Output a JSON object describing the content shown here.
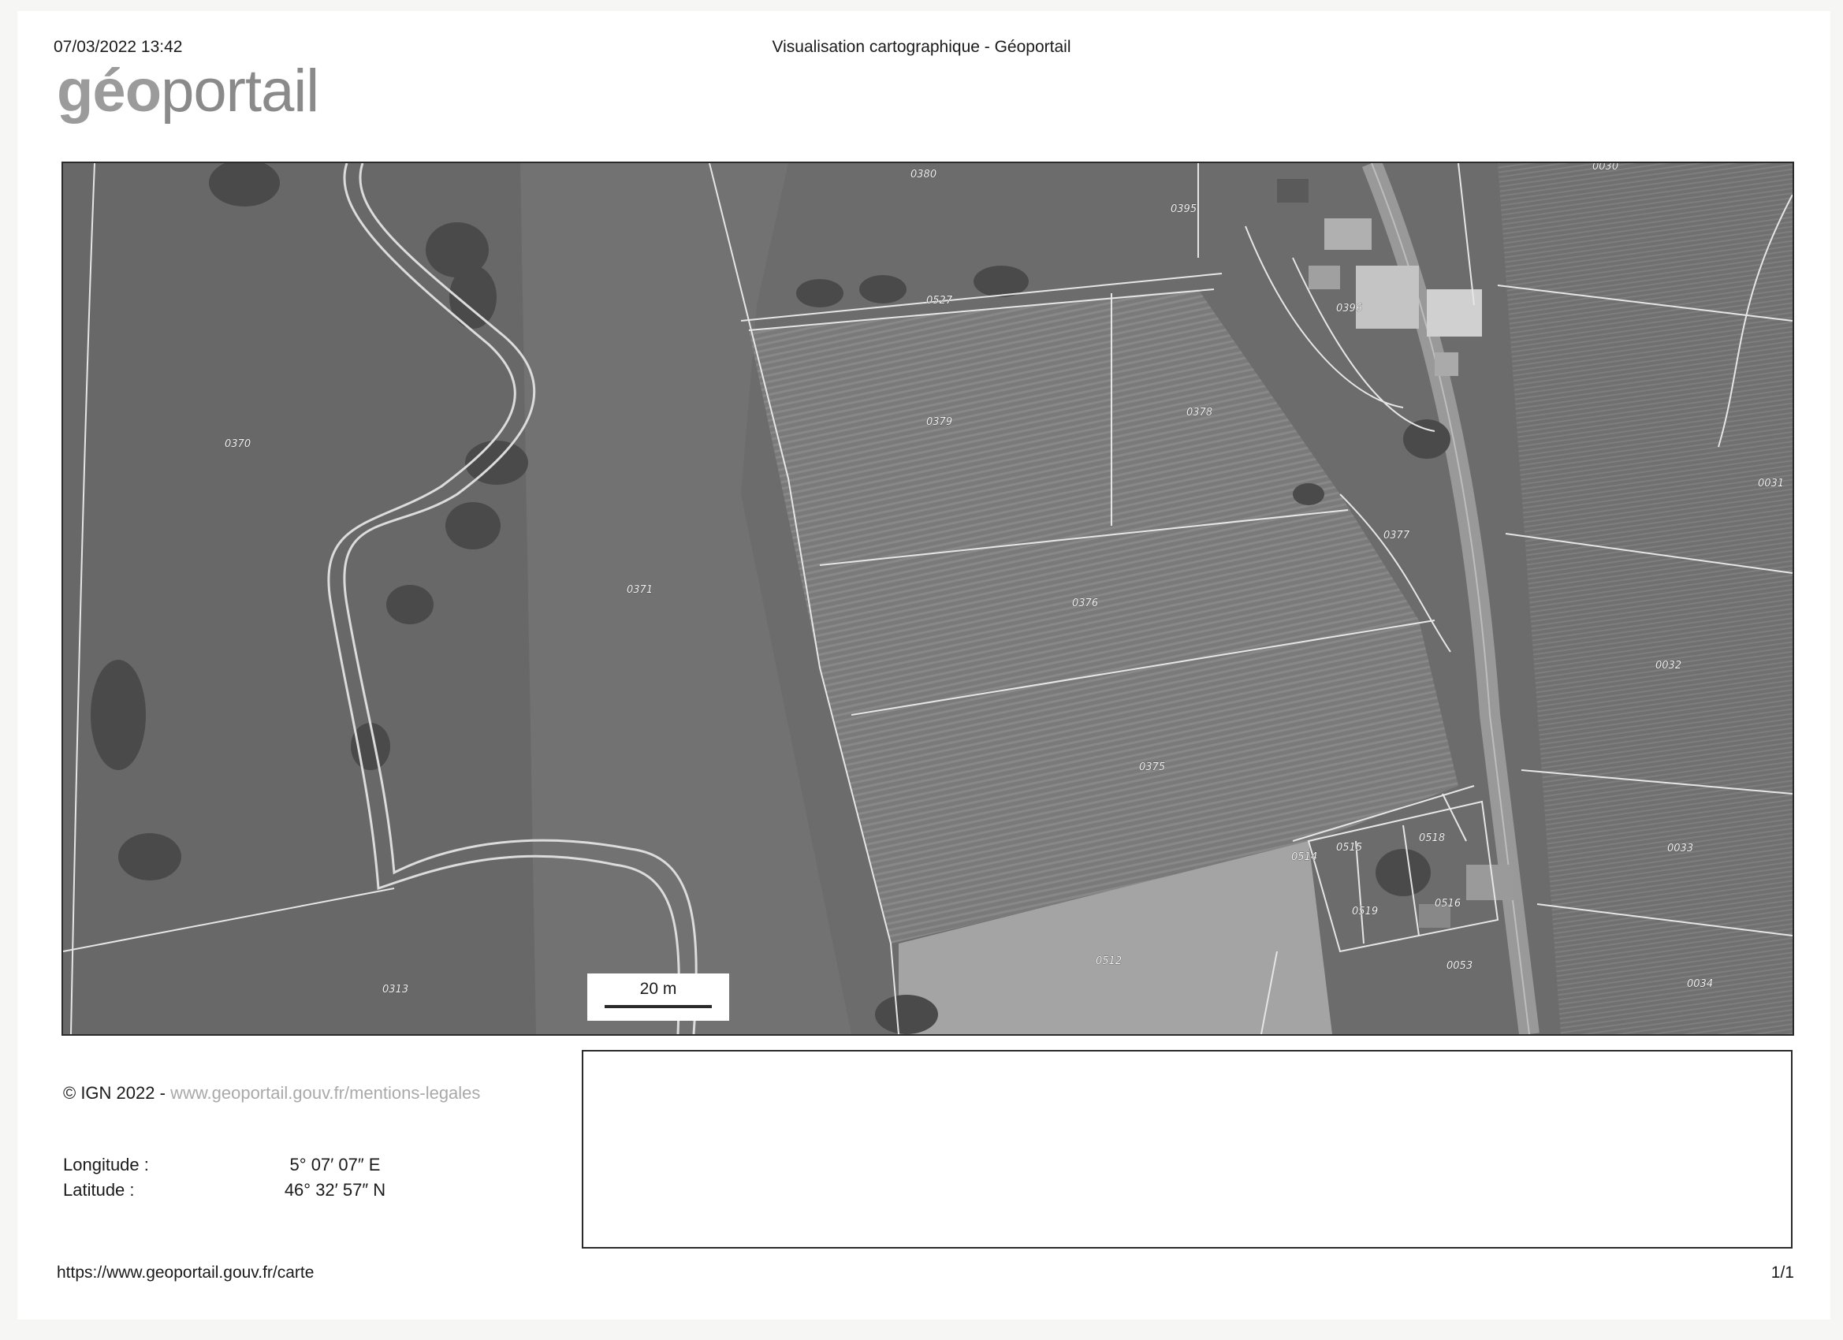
{
  "header": {
    "datetime": "07/03/2022 13:42",
    "title": "Visualisation cartographique - Géoportail"
  },
  "logo": {
    "part1": "géo",
    "part2": "portail"
  },
  "map": {
    "imagery": "aerial-photo-grayscale",
    "scale_label": "20 m",
    "parcels": [
      "0380",
      "0395",
      "0030",
      "0527",
      "0396",
      "0370",
      "0379",
      "0378",
      "0031",
      "0377",
      "0371",
      "0376",
      "0032",
      "0375",
      "0518",
      "0515",
      "0514",
      "0033",
      "0519",
      "0516",
      "0512",
      "0313",
      "0053",
      "0034"
    ]
  },
  "footer": {
    "copyright": "© IGN 2022 -",
    "legal_link": "www.geoportail.gouv.fr/mentions-legales",
    "longitude_label": "Longitude :",
    "longitude_value": "5° 07′ 07″ E",
    "latitude_label": "Latitude :",
    "latitude_value": "46° 32′ 57″ N",
    "url": "https://www.geoportail.gouv.fr/carte",
    "page": "1/1"
  }
}
